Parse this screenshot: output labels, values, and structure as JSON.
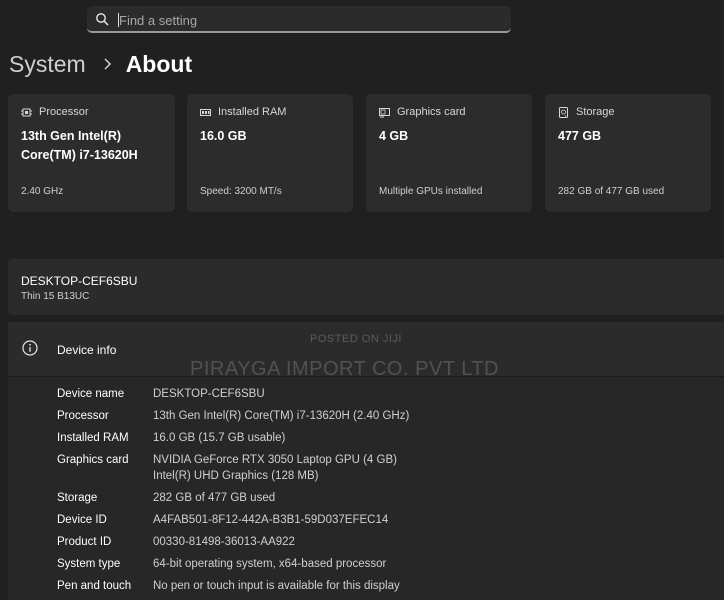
{
  "search": {
    "placeholder": "Find a setting"
  },
  "breadcrumb": {
    "parent": "System",
    "current": "About"
  },
  "cards": [
    {
      "icon": "processor-icon",
      "title": "Processor",
      "value": "13th Gen Intel(R) Core(TM) i7-13620H",
      "sub": "2.40 GHz"
    },
    {
      "icon": "ram-icon",
      "title": "Installed RAM",
      "value": "16.0 GB",
      "sub": "Speed: 3200 MT/s"
    },
    {
      "icon": "graphics-card-icon",
      "title": "Graphics card",
      "value": "4 GB",
      "sub": "Multiple GPUs installed"
    },
    {
      "icon": "storage-icon",
      "title": "Storage",
      "value": "477 GB",
      "sub": "282 GB of 477 GB used"
    }
  ],
  "device": {
    "name": "DESKTOP-CEF6SBU",
    "model": "Thin 15 B13UC"
  },
  "device_info": {
    "title": "Device info",
    "rows": [
      {
        "label": "Device name",
        "value": "DESKTOP-CEF6SBU"
      },
      {
        "label": "Processor",
        "value": "13th Gen Intel(R) Core(TM) i7-13620H (2.40 GHz)"
      },
      {
        "label": "Installed RAM",
        "value": "16.0 GB (15.7 GB usable)"
      },
      {
        "label": "Graphics card",
        "value": "NVIDIA GeForce RTX 3050 Laptop GPU (4 GB)",
        "value2": "Intel(R) UHD Graphics (128 MB)"
      },
      {
        "label": "Storage",
        "value": "282 GB of 477 GB used"
      },
      {
        "label": "Device ID",
        "value": "A4FAB501-8F12-442A-B3B1-59D037EFEC14"
      },
      {
        "label": "Product ID",
        "value": "00330-81498-36013-AA922"
      },
      {
        "label": "System type",
        "value": "64-bit operating system, x64-based processor"
      },
      {
        "label": "Pen and touch",
        "value": "No pen or touch input is available for this display"
      }
    ]
  },
  "watermark": {
    "line1": "POSTED ON JIJI",
    "line2": "PIRAYGA IMPORT CO. PVT LTD"
  }
}
